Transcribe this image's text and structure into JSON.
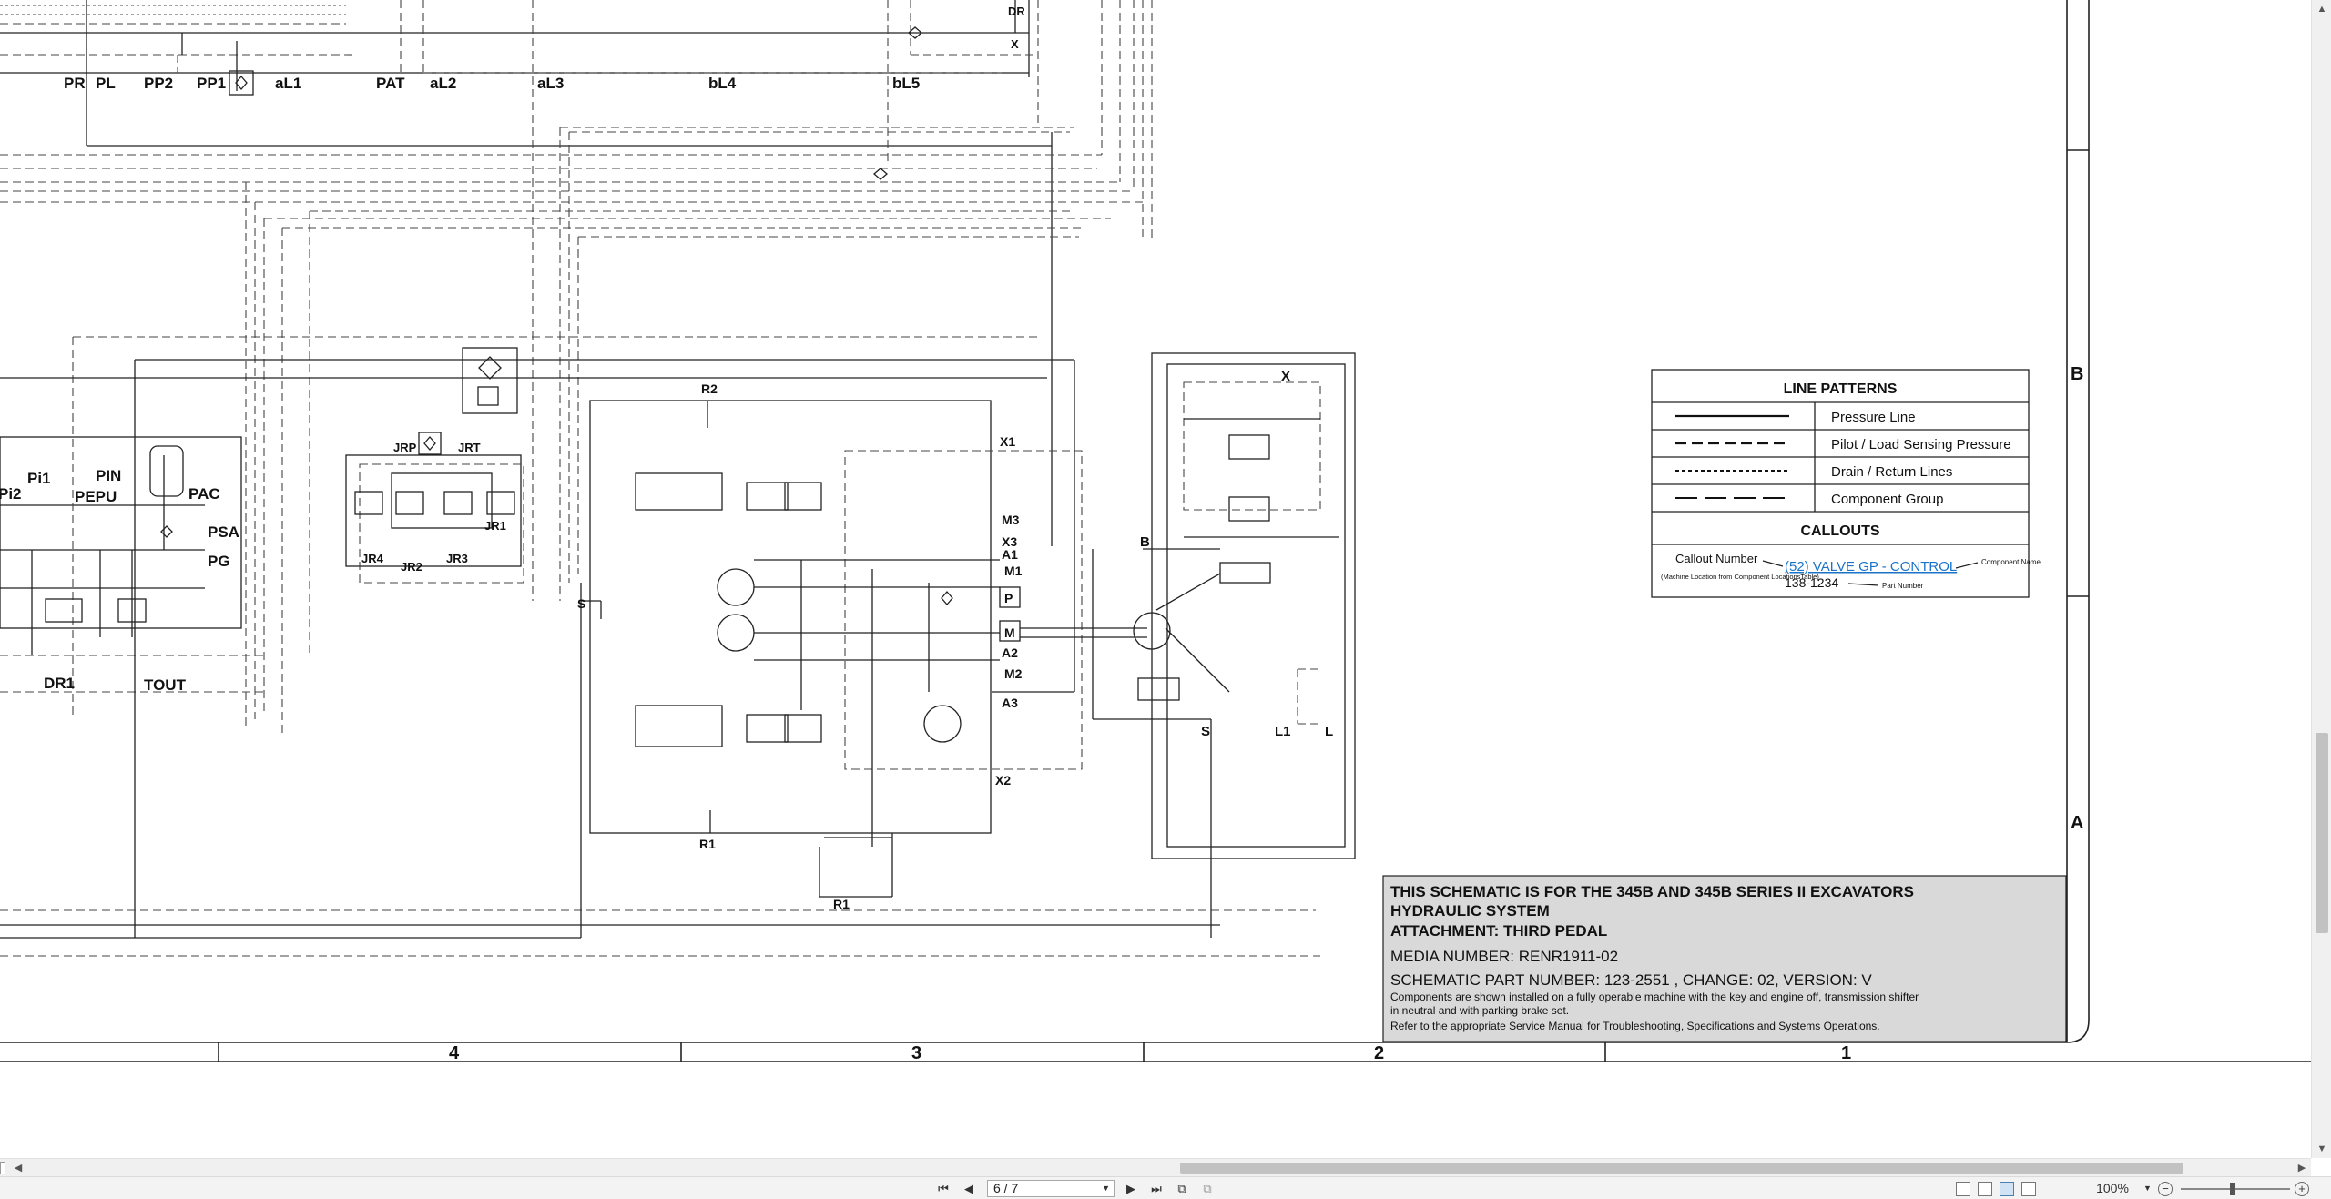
{
  "schematic": {
    "labels_top": {
      "pr": "PR",
      "pl": "PL",
      "pp2": "PP2",
      "pp1": "PP1",
      "al1": "aL1",
      "pat": "PAT",
      "al2": "aL2",
      "al3": "aL3",
      "bl4": "bL4",
      "bl5": "bL5",
      "dr": "DR",
      "x": "X"
    },
    "labels_left": {
      "pi2": "Pi2",
      "pi1": "Pi1",
      "pin": "PIN",
      "pepu": "PEPU",
      "pac": "PAC",
      "psa": "PSA",
      "pg": "PG",
      "dr1": "DR1",
      "tout": "TOUT"
    },
    "labels_jr": {
      "jrp": "JRP",
      "jrt": "JRT",
      "jr4": "JR4",
      "jr2": "JR2",
      "jr3": "JR3",
      "jr1": "JR1"
    },
    "labels_pump": {
      "r2": "R2",
      "x1": "X1",
      "m3": "M3",
      "x3": "X3",
      "a1": "A1",
      "m1": "M1",
      "p": "P",
      "m": "M",
      "a2": "A2",
      "m2": "M2",
      "a3": "A3",
      "x2": "X2",
      "r1a": "R1",
      "r1b": "R1",
      "s": "S"
    },
    "labels_right": {
      "x": "X",
      "b": "B",
      "s": "S",
      "l1": "L1",
      "l": "L"
    }
  },
  "border": {
    "columns": [
      "4",
      "3",
      "2",
      "1"
    ],
    "rows": [
      "B",
      "A"
    ]
  },
  "legend": {
    "title": "LINE PATTERNS",
    "items": [
      {
        "label": "Pressure Line",
        "pattern": "solid"
      },
      {
        "label": "Pilot / Load Sensing Pressure",
        "pattern": "dashed"
      },
      {
        "label": "Drain / Return Lines",
        "pattern": "dotted"
      },
      {
        "label": "Component Group",
        "pattern": "dash-long"
      }
    ],
    "callouts_title": "CALLOUTS",
    "callout_number_label": "Callout Number",
    "callout_number_note": "(Machine Location from Component LocationsTable)",
    "callout_example": "(52) VALVE GP - CONTROL",
    "component_name_label": "Component Name",
    "part_number_example": "138-1234",
    "part_number_label": "Part Number"
  },
  "title_block": {
    "line1": "THIS SCHEMATIC IS FOR THE 345B AND 345B SERIES II EXCAVATORS",
    "line2": "HYDRAULIC SYSTEM",
    "line3": "ATTACHMENT: THIRD PEDAL",
    "media_number": "MEDIA NUMBER: RENR1911-02",
    "part_number": "SCHEMATIC PART NUMBER: 123-2551 , CHANGE: 02, VERSION: V",
    "note1": "Components are shown installed on a fully operable machine with the key and engine off, transmission shifter",
    "note2": "in neutral and with parking brake set.",
    "note3": "Refer to the appropriate Service Manual for Troubleshooting, Specifications and Systems Operations."
  },
  "navigation": {
    "page_value": "6 / 7",
    "zoom_value": "100%"
  },
  "colors": {
    "line": "#222222",
    "title_block_bg": "#d9d9d9",
    "callout_link": "#1a73c9",
    "scrollbar_thumb": "#c2c2c2"
  }
}
